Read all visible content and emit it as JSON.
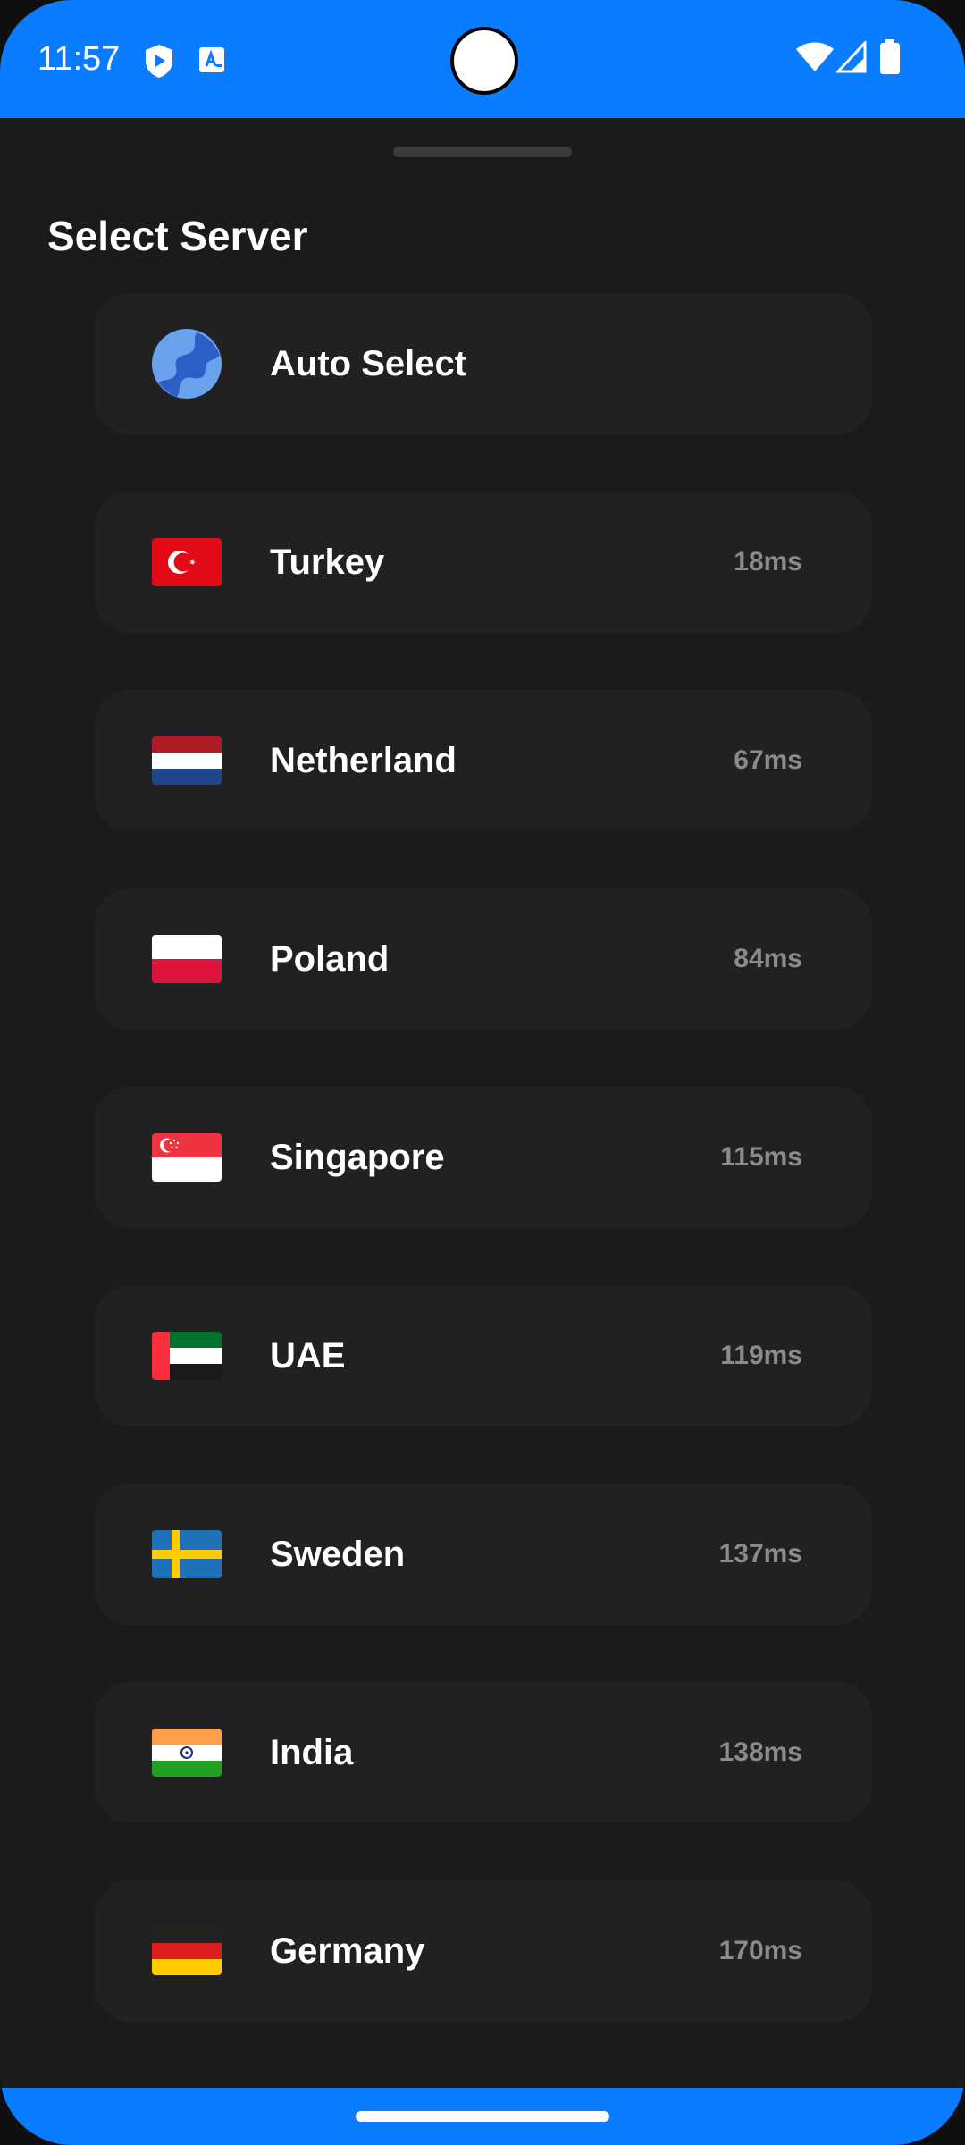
{
  "status_bar": {
    "time": "11:57",
    "left_icons": [
      "shield-play-icon",
      "translate-icon"
    ],
    "right_icons": [
      "wifi-icon",
      "signal-icon",
      "battery-icon"
    ],
    "color": "#0a7cff"
  },
  "sheet": {
    "title": "Select Server"
  },
  "servers": [
    {
      "name": "Auto Select",
      "ping": "",
      "icon": "globe-icon"
    },
    {
      "name": "Turkey",
      "ping": "18ms",
      "icon": "turkey-flag-icon"
    },
    {
      "name": "Netherland",
      "ping": "67ms",
      "icon": "netherlands-flag-icon"
    },
    {
      "name": "Poland",
      "ping": "84ms",
      "icon": "poland-flag-icon"
    },
    {
      "name": "Singapore",
      "ping": "115ms",
      "icon": "singapore-flag-icon"
    },
    {
      "name": "UAE",
      "ping": "119ms",
      "icon": "uae-flag-icon"
    },
    {
      "name": "Sweden",
      "ping": "137ms",
      "icon": "sweden-flag-icon"
    },
    {
      "name": "India",
      "ping": "138ms",
      "icon": "india-flag-icon"
    },
    {
      "name": "Germany",
      "ping": "170ms",
      "icon": "germany-flag-icon"
    }
  ],
  "colors": {
    "accent": "#0a7cff",
    "background": "#1b1b1b",
    "card": "#212121",
    "ping_text": "#8b8b8b"
  }
}
